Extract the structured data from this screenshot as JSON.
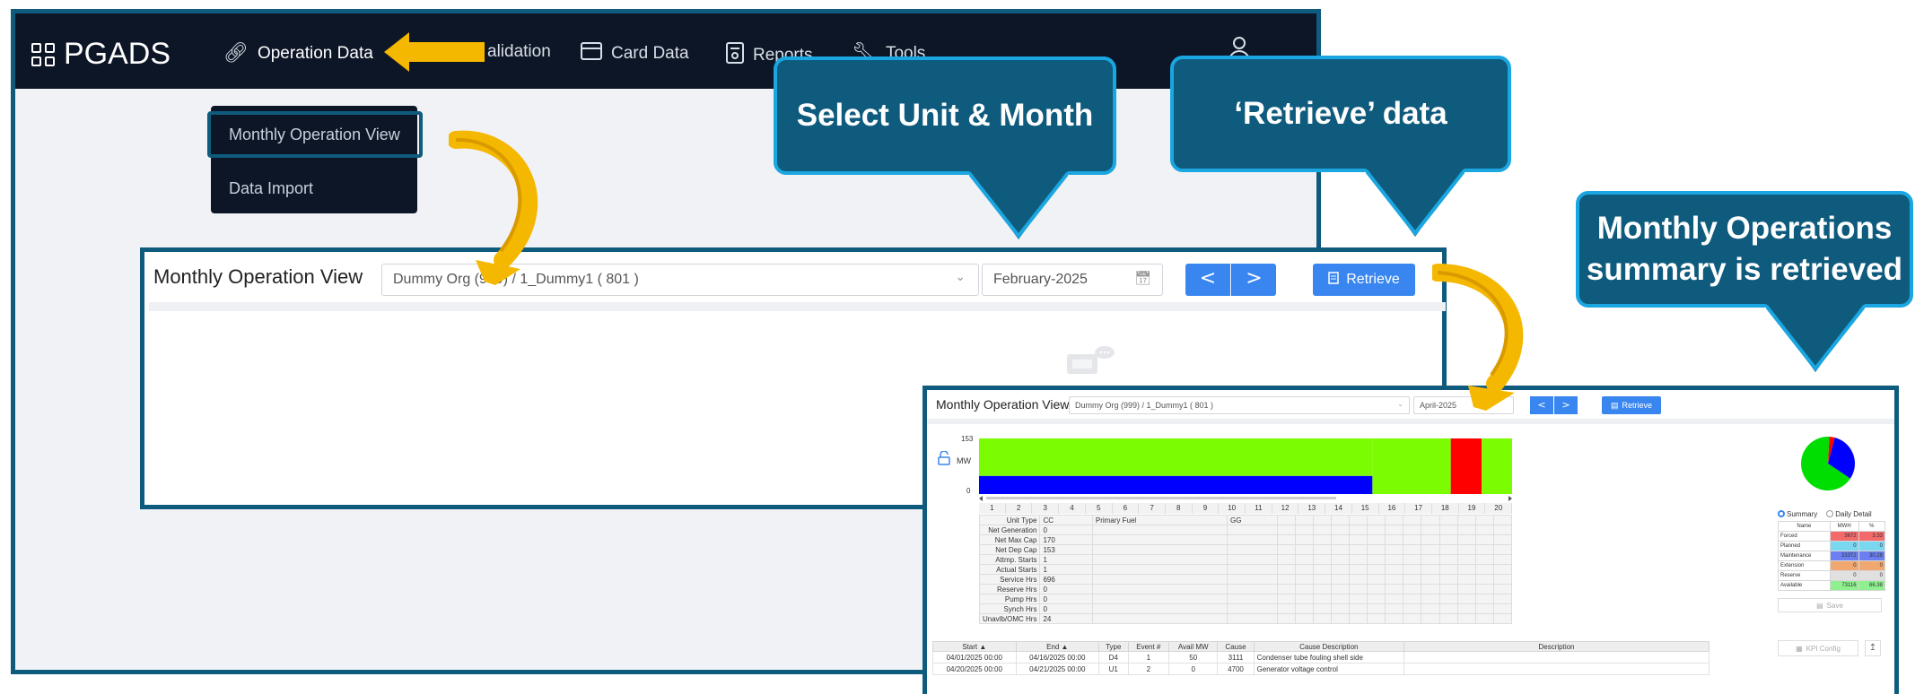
{
  "app": {
    "logo": "PGADS",
    "nav": [
      {
        "label": "Operation Data",
        "icon": "link-icon"
      },
      {
        "label": "alidation",
        "icon": "validation-icon"
      },
      {
        "label": "Card Data",
        "icon": "card-icon"
      },
      {
        "label": "Reports",
        "icon": "report-icon"
      },
      {
        "label": "Tools",
        "icon": "wrench-icon"
      }
    ],
    "user_icon": "user-icon"
  },
  "dropdown": {
    "items": [
      "Monthly Operation View",
      "Data Import"
    ]
  },
  "callouts": {
    "select": "Select Unit & Month",
    "retrieve": "‘Retrieve’ data",
    "summary": "Monthly Operations summary is retrieved"
  },
  "mid_panel": {
    "title": "Monthly Operation View",
    "unit_value": "Dummy Org (999) / 1_Dummy1 ( 801 )",
    "month_value": "February-2025",
    "retrieve_label": "Retrieve",
    "prev": "<",
    "next": ">"
  },
  "result_panel": {
    "title": "Monthly Operation View",
    "unit_value": "Dummy Org (999) / 1_Dummy1 ( 801 )",
    "month_value": "April-2025",
    "retrieve_label": "Retrieve",
    "prev": "<",
    "next": ">",
    "y_unit": "MW",
    "y_max": "153",
    "y_min": "0",
    "days": [
      "1",
      "2",
      "3",
      "4",
      "5",
      "6",
      "7",
      "8",
      "9",
      "10",
      "11",
      "12",
      "13",
      "14",
      "15",
      "16",
      "17",
      "18",
      "19",
      "20"
    ],
    "stats": [
      {
        "label": "Unit Type",
        "v1": "CC",
        "v2": "Primary Fuel",
        "v3": "GG"
      },
      {
        "label": "Net Generation",
        "v1": "0",
        "v2": "",
        "v3": ""
      },
      {
        "label": "Net Max Cap",
        "v1": "170",
        "v2": "",
        "v3": ""
      },
      {
        "label": "Net Dep Cap",
        "v1": "153",
        "v2": "",
        "v3": ""
      },
      {
        "label": "Attmp. Starts",
        "v1": "1",
        "v2": "",
        "v3": ""
      },
      {
        "label": "Actual Starts",
        "v1": "1",
        "v2": "",
        "v3": ""
      },
      {
        "label": "Service Hrs",
        "v1": "696",
        "v2": "",
        "v3": ""
      },
      {
        "label": "Reserve Hrs",
        "v1": "0",
        "v2": "",
        "v3": ""
      },
      {
        "label": "Pump Hrs",
        "v1": "0",
        "v2": "",
        "v3": ""
      },
      {
        "label": "Synch Hrs",
        "v1": "0",
        "v2": "",
        "v3": ""
      },
      {
        "label": "Unavlb/OMC Hrs",
        "v1": "24",
        "v2": "",
        "v3": ""
      }
    ],
    "events_headers": [
      "Start ▲",
      "End ▲",
      "Type",
      "Event #",
      "Avail MW",
      "Cause",
      "Cause Description",
      "Description"
    ],
    "events": [
      [
        "04/01/2025 00:00",
        "04/16/2025 00:00",
        "D4",
        "1",
        "50",
        "3111",
        "Condenser tube fouling shell side",
        ""
      ],
      [
        "04/20/2025 00:00",
        "04/21/2025 00:00",
        "U1",
        "2",
        "0",
        "4700",
        "Generator voltage control",
        ""
      ]
    ],
    "radio_summary": "Summary",
    "radio_daily": "Daily Detail",
    "summary_headers": [
      "Name",
      "MWH",
      "%"
    ],
    "summary_rows": [
      {
        "name": "Forced",
        "mwh": "3672",
        "pct": "3.33",
        "color": "#f46a6a"
      },
      {
        "name": "Planned",
        "mwh": "0",
        "pct": "0",
        "color": "#7ad7f0"
      },
      {
        "name": "Maintenance",
        "mwh": "33372",
        "pct": "30.28",
        "color": "#6b7ff0"
      },
      {
        "name": "Extension",
        "mwh": "0",
        "pct": "0",
        "color": "#f0a870"
      },
      {
        "name": "Reserve",
        "mwh": "0",
        "pct": "0",
        "color": "#e0e0e0"
      },
      {
        "name": "Available",
        "mwh": "73116",
        "pct": "66.38",
        "color": "#8ef08e"
      }
    ],
    "save_label": "Save",
    "kpi_label": "KPI Config",
    "export_icon": "upload-icon"
  },
  "colors": {
    "nav_bg": "#0d1626",
    "frame": "#0f5b7d",
    "callout_border": "#1aa6e0",
    "primary_button": "#3a86f0",
    "arrow_yellow": "#f5b800",
    "chart_blue": "#0000ff",
    "chart_green": "#7cfc00",
    "chart_red": "#ff0000"
  },
  "chart_data": {
    "type": "bar",
    "title": "",
    "ylabel": "MW",
    "ylim": [
      0,
      153
    ],
    "x": [
      "1",
      "2",
      "3",
      "4",
      "5",
      "6",
      "7",
      "8",
      "9",
      "10",
      "11",
      "12",
      "13",
      "14",
      "15",
      "16",
      "17",
      "18",
      "19",
      "20"
    ],
    "series": [
      {
        "color": "#0000ff",
        "segments": [
          {
            "start_day": 1,
            "end_day": 16,
            "value_mw": 50
          }
        ]
      },
      {
        "color": "#7cfc00",
        "segments": [
          {
            "start_day": 1,
            "end_day": 16,
            "value_mw": 103
          },
          {
            "start_day": 16,
            "end_day": 20,
            "value_mw": 153
          },
          {
            "start_day": 21,
            "end_day": 21,
            "value_mw": 153
          }
        ]
      },
      {
        "color": "#ff0000",
        "segments": [
          {
            "start_day": 20,
            "end_day": 21,
            "value_mw": 153
          }
        ]
      }
    ],
    "pie": [
      {
        "name": "Forced",
        "value": 3.33,
        "color": "#ff0000"
      },
      {
        "name": "Maintenance",
        "value": 30.28,
        "color": "#0000ff"
      },
      {
        "name": "Available",
        "value": 66.38,
        "color": "#00dd00"
      }
    ]
  }
}
